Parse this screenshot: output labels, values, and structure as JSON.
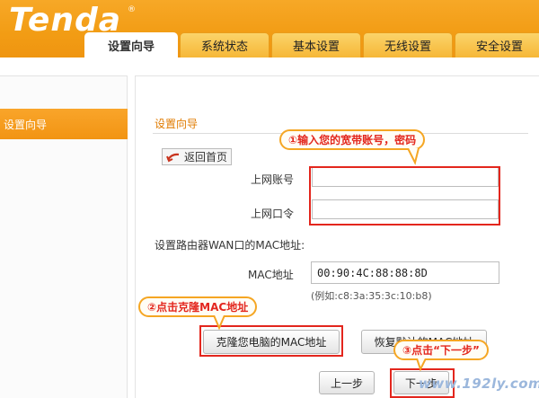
{
  "brand": {
    "logo_text": "Tenda",
    "reg_mark": "®"
  },
  "tabs": [
    {
      "label": "设置向导",
      "active": true
    },
    {
      "label": "系统状态",
      "active": false
    },
    {
      "label": "基本设置",
      "active": false
    },
    {
      "label": "无线设置",
      "active": false
    },
    {
      "label": "安全设置",
      "active": false
    }
  ],
  "sidebar": {
    "items": [
      {
        "label": "设置向导",
        "active": true
      }
    ]
  },
  "main": {
    "section_title": "设置向导",
    "home_button": "返回首页",
    "account_label": "上网账号",
    "account_value": "",
    "password_label": "上网口令",
    "password_value": "",
    "mac_section_label": "设置路由器WAN口的MAC地址:",
    "mac_label": "MAC地址",
    "mac_value": "00:90:4C:88:88:8D",
    "mac_hint": "(例如:c8:3a:35:3c:10:b8)",
    "clone_mac_button": "克隆您电脑的MAC地址",
    "restore_mac_button": "恢复默认的MAC地址",
    "prev_button": "上一步",
    "next_button": "下一步"
  },
  "annotations": {
    "step1": "①输入您的宽带账号，密码",
    "step2": "②点击克隆MAC地址",
    "step3": "③点击“下一步”",
    "color": "#e3261d",
    "bubble_border": "#f5a623"
  },
  "watermark": "www.192ly.com",
  "colors": {
    "brand_orange": "#f29c14",
    "title_orange": "#e07b00"
  }
}
